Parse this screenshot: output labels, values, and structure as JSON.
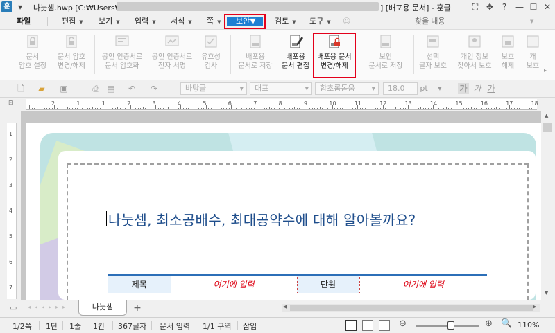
{
  "window": {
    "title_start": "나눗셈.hwp [C:₩Users₩",
    "title_end": "] [배포용 문서] - 훈글",
    "app_logo": "훈"
  },
  "menu": {
    "file": "파일",
    "items": [
      "편집",
      "보기",
      "입력",
      "서식",
      "쪽"
    ],
    "security": "보안",
    "review": "검토",
    "tools": "도구",
    "search_placeholder": "찾을 내용"
  },
  "ribbon": {
    "buttons": [
      {
        "label1": "문서",
        "label2": "암호 설정",
        "icon": "lock-doc-icon"
      },
      {
        "label1": "문서 암호",
        "label2": "변경/해제",
        "icon": "lock-change-icon"
      },
      {
        "label1": "공인 인증서로",
        "label2": "문서 암호화",
        "icon": "cert-encrypt-icon"
      },
      {
        "label1": "공인 인증서로",
        "label2": "전자 서명",
        "icon": "cert-sign-icon"
      },
      {
        "label1": "유효성",
        "label2": "검사",
        "icon": "validate-icon"
      },
      {
        "label1": "배포용",
        "label2": "문서로 저장",
        "icon": "dist-save-icon"
      },
      {
        "label1": "배포용",
        "label2": "문서 편집",
        "icon": "dist-edit-icon"
      },
      {
        "label1": "배포용 문서",
        "label2": "변경/해제",
        "icon": "dist-change-icon"
      },
      {
        "label1": "보안",
        "label2": "문서로 저장",
        "icon": "secure-save-icon"
      },
      {
        "label1": "선택",
        "label2": "글자 보호",
        "icon": "select-protect-icon"
      },
      {
        "label1": "개인 정보",
        "label2": "찾아서 보호",
        "icon": "privacy-icon"
      },
      {
        "label1": "보호",
        "label2": "해제",
        "icon": "unprotect-icon"
      },
      {
        "label1": "개",
        "label2": "보호",
        "icon": "protect-icon"
      }
    ]
  },
  "format": {
    "style": "바탕글",
    "paragraph": "대표",
    "font": "함초롬돋움",
    "size": "18.0",
    "unit": "pt",
    "b1": "가",
    "b2": "가",
    "b3": "가"
  },
  "ruler": {
    "marks": [
      "2",
      "1",
      "1",
      "2",
      "3",
      "4",
      "5",
      "6",
      "7",
      "8",
      "9",
      "10",
      "11",
      "12",
      "13",
      "14",
      "15",
      "16",
      "17",
      "18"
    ],
    "vmarks": [
      "1",
      "2",
      "3",
      "4",
      "5",
      "6",
      "7"
    ]
  },
  "document": {
    "title": "나눗셈, 최소공배수, 최대공약수에 대해 알아볼까요?",
    "table": {
      "c1": "제목",
      "c2": "여기에 입력",
      "c3": "단원",
      "c4": "여기에 입력"
    }
  },
  "tabs": {
    "sheet": "나눗셈",
    "add": "+"
  },
  "status": {
    "page": "1/2쪽",
    "section": "1단",
    "line": "1줄",
    "col": "1칸",
    "chars": "367글자",
    "mode": "문서 입력",
    "area": "1/1 구역",
    "insert": "삽입",
    "zoom": "110%",
    "zoom_level_percent": 110
  }
}
